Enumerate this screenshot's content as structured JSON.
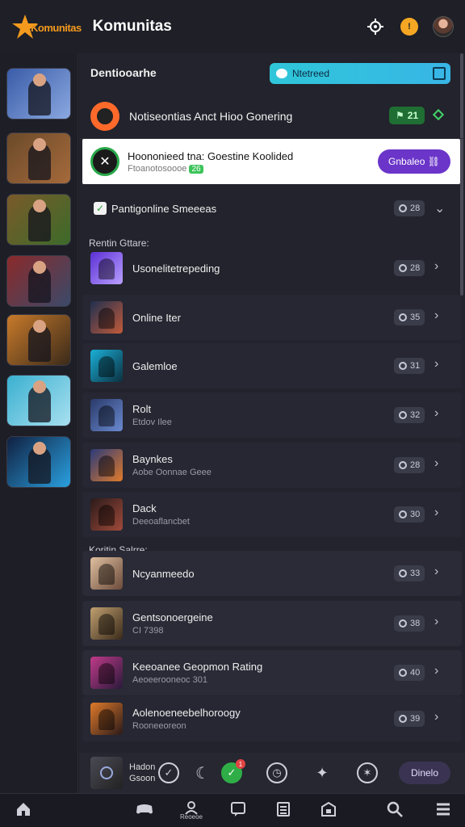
{
  "header": {
    "logo_text": "Komunitas",
    "title": "Komunitas",
    "icons": [
      "settings-icon",
      "notification-icon",
      "user-avatar"
    ]
  },
  "sidebar": {
    "thumbs": [
      {
        "name": "game-thumb-1",
        "colors": [
          "#3a5ca8",
          "#8aa8e0"
        ]
      },
      {
        "name": "game-thumb-2",
        "colors": [
          "#6b4a2a",
          "#a56a3b"
        ]
      },
      {
        "name": "game-thumb-3",
        "colors": [
          "#7a5a2a",
          "#3c6b2a"
        ]
      },
      {
        "name": "game-thumb-4",
        "colors": [
          "#8a2a2a",
          "#3a4a6a"
        ]
      },
      {
        "name": "game-thumb-5",
        "colors": [
          "#c87a2a",
          "#3a2a1a"
        ]
      },
      {
        "name": "game-thumb-6",
        "colors": [
          "#3ab0d0",
          "#a8e0f0"
        ]
      },
      {
        "name": "game-thumb-7",
        "colors": [
          "#102040",
          "#2aa0e0"
        ]
      }
    ]
  },
  "main": {
    "filter_title": "Dentiooarhe",
    "filter_button": "Ntetreed",
    "feature": {
      "title": "Notiseontias Anct Hioo Gonering",
      "pill": "21"
    },
    "promo": {
      "title": "Hoononieed tna: Goestine Koolided",
      "subtitle": "Ftoanotosoooe",
      "tag": "26",
      "button": "Gnbaleo"
    },
    "checkbox_row": {
      "label": "Pantigonline Smeeeas",
      "pill": "28"
    },
    "section1_label": "Rentin Gttare:",
    "section2_label": "Koritin Salrre:",
    "games": [
      {
        "title": "Usonelitetrepeding",
        "subtitle": "",
        "pill": "28",
        "colors": [
          "#5b2fd4",
          "#b9a0ff"
        ]
      },
      {
        "title": "Online Iter",
        "subtitle": "",
        "pill": "35",
        "colors": [
          "#203050",
          "#c25a3a"
        ]
      },
      {
        "title": "Galemloe",
        "subtitle": "",
        "pill": "31",
        "colors": [
          "#1ab0d8",
          "#0c3040"
        ]
      },
      {
        "title": "Rolt",
        "subtitle": "Etdov Ilee",
        "pill": "32",
        "colors": [
          "#2a3a6a",
          "#6a8ad0"
        ]
      },
      {
        "title": "Baynkes",
        "subtitle": "Aobe Oonnae Geee",
        "pill": "28",
        "colors": [
          "#2a3a7a",
          "#e07a2a"
        ]
      },
      {
        "title": "Dack",
        "subtitle": "Deeoaflancbet",
        "pill": "30",
        "colors": [
          "#2a1a1a",
          "#a04a3a"
        ]
      },
      {
        "title": "Ncyanmeedo",
        "subtitle": "",
        "pill": "33",
        "colors": [
          "#e0c0a0",
          "#6a4a3a"
        ]
      },
      {
        "title": "Gentsonoergeine",
        "subtitle": "CI 7398",
        "pill": "38",
        "colors": [
          "#c0a070",
          "#3a2a1a"
        ]
      },
      {
        "title": "Keeoanee Geopmon Rating",
        "subtitle": "Aeoeerooneoc 301",
        "pill": "40",
        "colors": [
          "#c03a8a",
          "#2a1a3a"
        ]
      },
      {
        "title": "Aolenoeneebelhoroogy",
        "subtitle": "Rooneeoreon",
        "pill": "39",
        "colors": [
          "#e07a2a",
          "#2a1a1a"
        ]
      }
    ],
    "action_row": {
      "text_line1": "Hadon",
      "text_line2": "Gsoon",
      "badge": "1",
      "button": "Dinelo"
    }
  },
  "bottom_nav": {
    "items": [
      {
        "name": "nav-home",
        "icon": "home-icon",
        "label": ""
      },
      {
        "name": "nav-games",
        "icon": "gamepad-icon",
        "label": ""
      },
      {
        "name": "nav-community",
        "icon": "user-icon",
        "label": "Reoeoe"
      },
      {
        "name": "nav-chat",
        "icon": "chat-icon",
        "label": ""
      },
      {
        "name": "nav-list",
        "icon": "list-icon",
        "label": ""
      },
      {
        "name": "nav-store",
        "icon": "store-icon",
        "label": ""
      },
      {
        "name": "nav-search",
        "icon": "search-icon",
        "label": ""
      },
      {
        "name": "nav-menu",
        "icon": "menu-icon",
        "label": ""
      }
    ]
  }
}
